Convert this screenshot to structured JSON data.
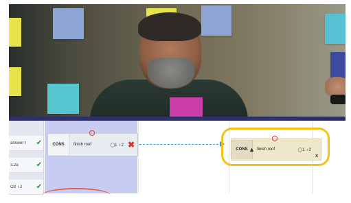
{
  "left_panel": {
    "items": [
      {
        "label": "answer t",
        "status": "✔"
      },
      {
        "label": "3.2a",
        "status": "✔"
      },
      {
        "label": "O3 ♁2",
        "status": "✔"
      }
    ]
  },
  "source_task": {
    "tag": "CONS",
    "text": "finish roof",
    "meta": "◯1 ♁2",
    "remove": "✖"
  },
  "target_task": {
    "tag": "CONS",
    "text": "finish roof",
    "meta": "◯1 ♁2",
    "remove": "x"
  },
  "colors": {
    "highlight": "#f2c21b",
    "dashed_link": "#3c95d6",
    "check": "#1f8c3a",
    "remove": "#d9332d"
  },
  "icons": {
    "check": "check-icon",
    "remove": "close-icon",
    "cursor": "pointer-cursor-icon",
    "marker": "red-circle-icon"
  }
}
